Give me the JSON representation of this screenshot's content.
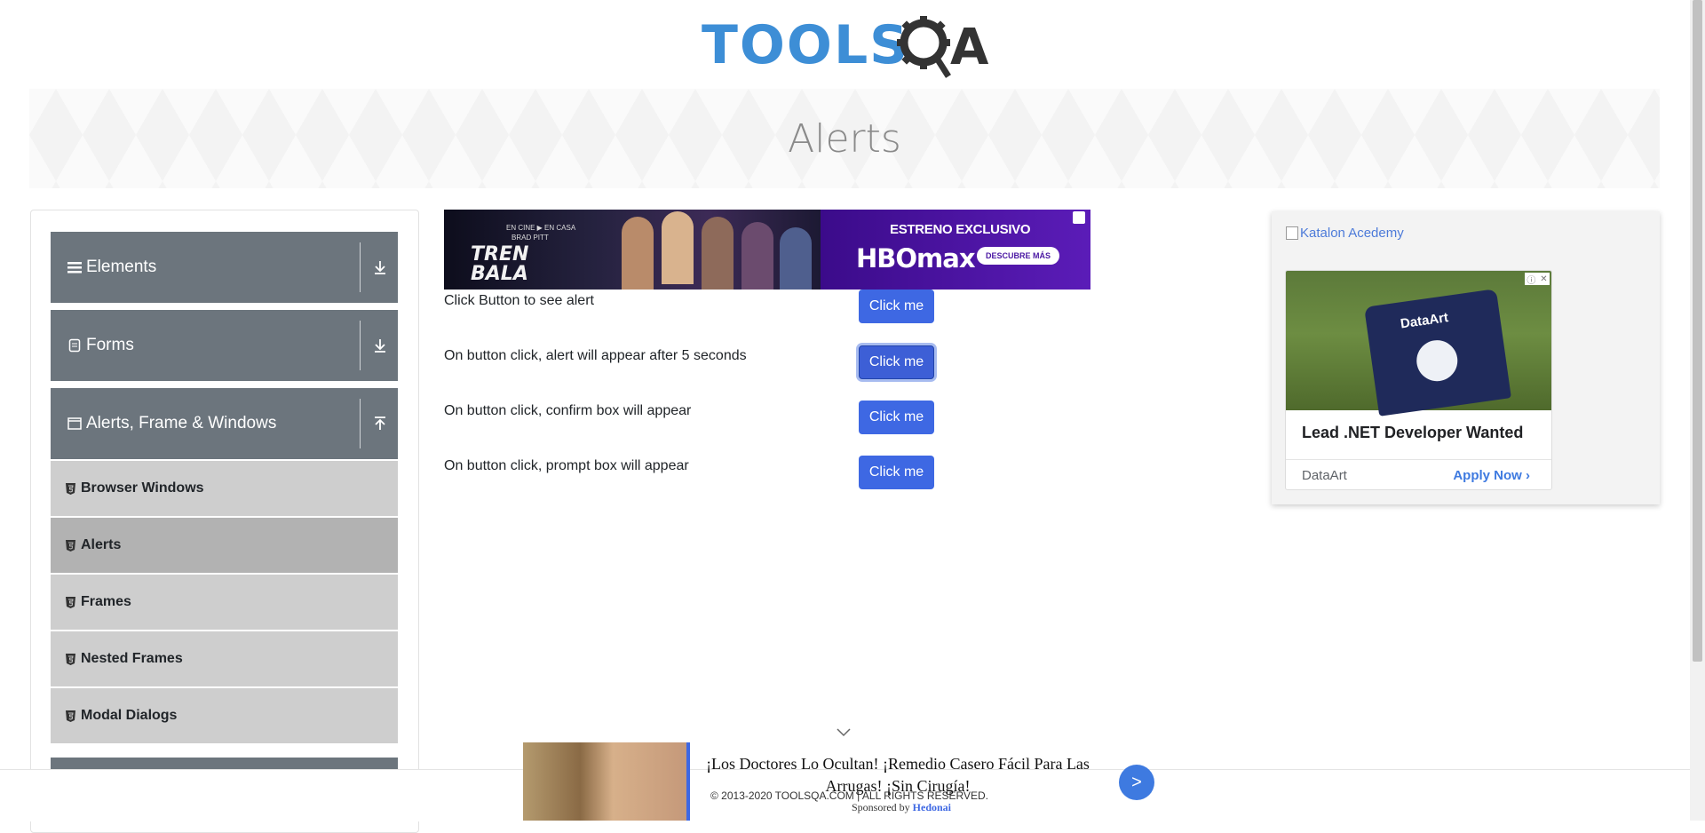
{
  "logo": {
    "text": "TOOLSQA",
    "word_left": "TOOLS",
    "word_right": "A"
  },
  "page": {
    "title": "Alerts"
  },
  "sidebar": {
    "groups": [
      {
        "label": "Elements",
        "icon": "hamburger-icon",
        "state": "collapsed"
      },
      {
        "label": "Forms",
        "icon": "document-icon",
        "state": "collapsed"
      },
      {
        "label": "Alerts, Frame & Windows",
        "icon": "window-icon",
        "state": "expanded"
      }
    ],
    "items": [
      {
        "label": "Browser Windows",
        "active": false
      },
      {
        "label": "Alerts",
        "active": true
      },
      {
        "label": "Frames",
        "active": false
      },
      {
        "label": "Nested Frames",
        "active": false
      },
      {
        "label": "Modal Dialogs",
        "active": false
      }
    ]
  },
  "ad_top": {
    "tag": "EN CINE ▶ EN CASA",
    "actor": "BRAD PITT",
    "movie_line1": "TREN",
    "movie_line2": "BALA",
    "headline": "ESTRENO EXCLUSIVO",
    "brand": "HBOmax",
    "cta": "DESCUBRE MÁS"
  },
  "alerts": [
    {
      "label": "Click Button to see alert",
      "button": "Click me"
    },
    {
      "label": "On button click, alert will appear after 5 seconds",
      "button": "Click me"
    },
    {
      "label": "On button click, confirm box will appear",
      "button": "Click me"
    },
    {
      "label": "On button click, prompt box will appear",
      "button": "Click me"
    }
  ],
  "ad_right": {
    "broken_image_alt": "Katalon Acedemy",
    "photo_text": "DataArt",
    "headline": "Lead .NET Developer Wanted",
    "advertiser": "DataArt",
    "cta": "Apply Now"
  },
  "footer": {
    "copyright": "© 2013-2020 TOOLSQA.COM | ALL RIGHTS RESERVED."
  },
  "ad_bottom": {
    "text": "¡Los Doctores Lo Ocultan! ¡Remedio Casero Fácil Para Las Arrugas! ¡Sin Cirugía!",
    "sponsored_prefix": "Sponsored by",
    "sponsor": "Hedonai",
    "go": ">"
  },
  "colors": {
    "primary_button": "#3e68e3",
    "sidebar_group": "#6c757d",
    "sidebar_item": "#cecece",
    "sidebar_item_active": "#b2b2b2",
    "logo_blue": "#3d8ed6",
    "logo_dark": "#333333"
  }
}
